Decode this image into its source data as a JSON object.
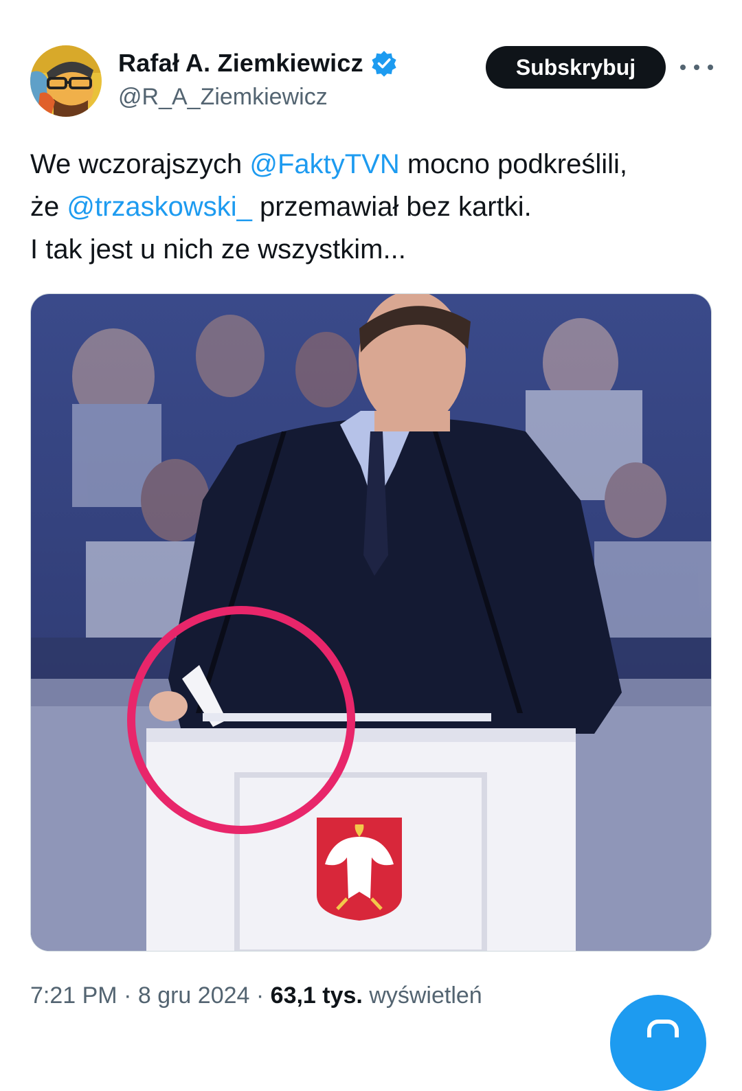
{
  "author": {
    "display_name": "Rafał A. Ziemkiewicz",
    "handle": "@R_A_Ziemkiewicz",
    "verified_icon": "verified-badge-icon"
  },
  "actions": {
    "subscribe_label": "Subskrybuj",
    "more_icon": "more-options-icon"
  },
  "tweet": {
    "line1_text_a": "We wczorajszych ",
    "line1_mention": "@FaktyTVN",
    "line1_text_b": " mocno podkreślili,",
    "line2_text_a": "że ",
    "line2_mention": "@trzaskowski_",
    "line2_text_b": " przemawiał bez kartki.",
    "line3_text": "I tak jest u nich ze wszystkim..."
  },
  "meta": {
    "time": "7:21 PM",
    "sep1": " · ",
    "date": "8 gru 2024",
    "sep2": " · ",
    "views_count": "63,1 tys.",
    "views_label": " wyświetleń"
  },
  "colors": {
    "accent": "#1d9bf0",
    "highlight_circle": "#e8266a",
    "button_bg": "#0f1419"
  }
}
